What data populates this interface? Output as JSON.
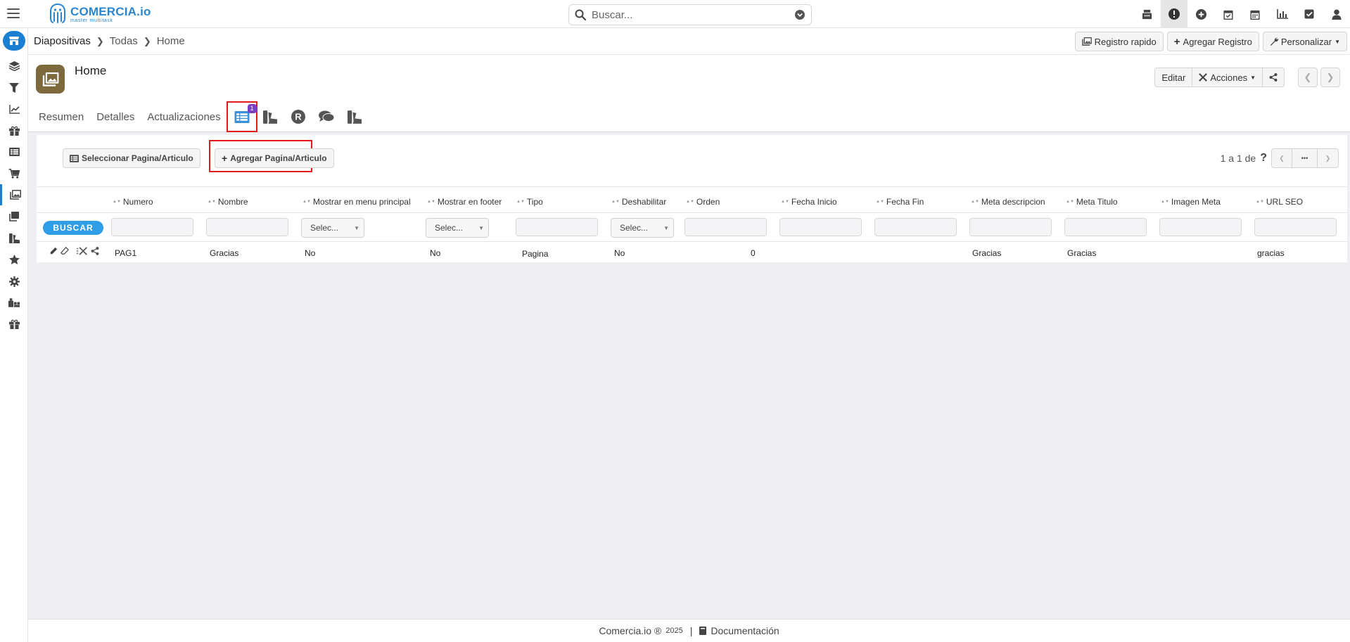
{
  "app": {
    "logo_name": "COMERCIA.io",
    "logo_sub": "master multitask",
    "colors": {
      "brand": "#2a86d1",
      "accent": "#1a7fd0",
      "record_icon": "#7d6a3c",
      "badge": "#7b3fc2",
      "highlight": "#e01b1b",
      "buscar": "#2f9ee6"
    }
  },
  "search": {
    "placeholder": "Buscar..."
  },
  "topbar_icons": [
    "calculator-icon",
    "alert-icon",
    "plus-circle-icon",
    "calendar-check-icon",
    "calendar-icon",
    "bar-chart-icon",
    "checkbox-icon",
    "user-icon"
  ],
  "breadcrumb": {
    "item1": "Diapositivas",
    "item2": "Todas",
    "item3": "Home"
  },
  "crumb_actions": {
    "quick": "Registro rapido",
    "add": "Agregar Registro",
    "customize": "Personalizar"
  },
  "sidebar_icons": [
    "store-icon",
    "layers-icon",
    "filter-icon",
    "line-chart-icon",
    "gift-icon",
    "list-icon",
    "cart-icon",
    "image-icon",
    "docs-icon",
    "swatch-icon",
    "star-icon",
    "gear-icon",
    "warehouse-icon",
    "gift-icon"
  ],
  "record": {
    "title": "Home",
    "edit": "Editar",
    "actions": "Acciones",
    "tabs": {
      "summary": "Resumen",
      "details": "Detalles",
      "updates": "Actualizaciones"
    },
    "badge_count": "1"
  },
  "panel": {
    "select_btn": "Seleccionar Pagina/Articulo",
    "add_btn": "Agregar Pagina/Articulo",
    "pager_text": "1 a 1  de",
    "pager_help": "?",
    "pager_more": "•••",
    "buscar": "BUSCAR",
    "columns": {
      "numero": "Numero",
      "nombre": "Nombre",
      "menu": "Mostrar en menu principal",
      "footer": "Mostrar en footer",
      "tipo": "Tipo",
      "deshabilitar": "Deshabilitar",
      "orden": "Orden",
      "inicio": "Fecha Inicio",
      "fin": "Fecha Fin",
      "meta_desc": "Meta descripcion",
      "meta_titulo": "Meta Titulo",
      "imagen_meta": "Imagen Meta",
      "url_seo": "URL SEO"
    },
    "select_placeholder": "Selec...",
    "row": {
      "numero": "PAG1",
      "nombre": "Gracias",
      "menu": "No",
      "footer": "No",
      "tipo": "Pagina",
      "deshabilitar": "No",
      "orden": "0",
      "inicio": "",
      "fin": "",
      "meta_desc": "Gracias",
      "meta_titulo": "Gracias",
      "imagen_meta": "",
      "url_seo": "gracias"
    }
  },
  "footer": {
    "brand": "Comercia.io ®",
    "year": "2025",
    "sep": "|",
    "docs": "Documentación"
  }
}
